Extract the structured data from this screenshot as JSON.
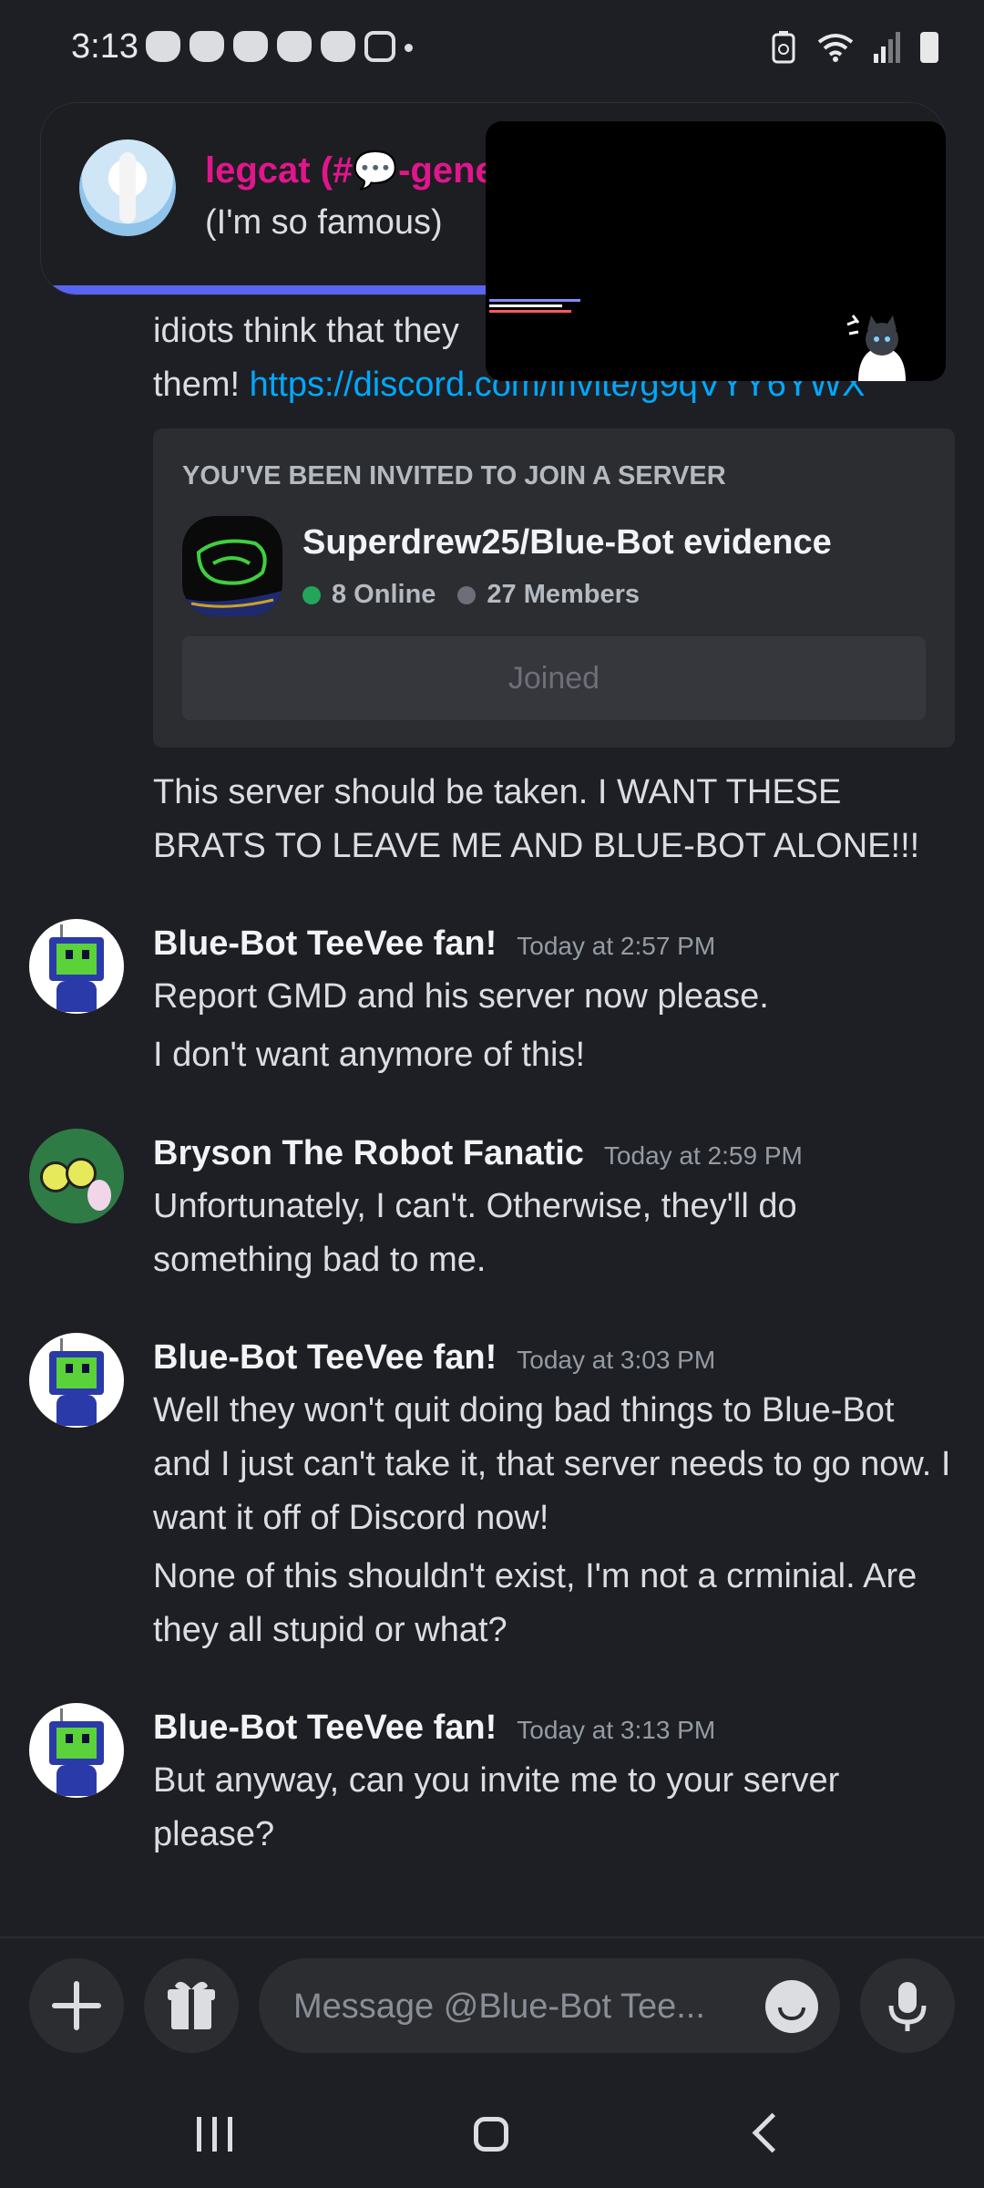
{
  "status_bar": {
    "time": "3:13",
    "notification_icons": [
      "discord-icon",
      "discord-icon",
      "discord-icon",
      "discord-icon",
      "discord-icon",
      "instagram-icon"
    ]
  },
  "notification": {
    "title": "legcat (#💬-general)",
    "text": "(I'm so famous)"
  },
  "chat": {
    "partial_message": {
      "line1": "idiots think that they",
      "line2_prefix": "them! ",
      "link": "https://discord.com/invite/g9qVYY6YWX"
    },
    "invite": {
      "header": "YOU'VE BEEN INVITED TO JOIN A SERVER",
      "server_name": "Superdrew25/Blue-Bot evidence",
      "online": "8 Online",
      "members": "27 Members",
      "button": "Joined"
    },
    "message_after_invite": "This server should be taken. I WANT THESE BRATS TO LEAVE ME AND BLUE-BOT ALONE!!!",
    "messages": [
      {
        "author": "Blue-Bot TeeVee fan!",
        "timestamp": "Today at 2:57 PM",
        "lines": [
          "Report GMD and his server now please.",
          "I don't want anymore of this!"
        ]
      },
      {
        "author": "Bryson The Robot Fanatic",
        "timestamp": "Today at 2:59 PM",
        "lines": [
          "Unfortunately, I can't. Otherwise, they'll do something bad to me."
        ]
      },
      {
        "author": "Blue-Bot TeeVee fan!",
        "timestamp": "Today at 3:03 PM",
        "lines": [
          "Well they won't quit doing bad things to Blue-Bot and I just can't take it, that server needs to go now. I want it off of Discord now!",
          "None of this shouldn't exist, I'm not a crminial. Are they all stupid or what?"
        ]
      },
      {
        "author": "Blue-Bot TeeVee fan!",
        "timestamp": "Today at 3:13 PM",
        "lines": [
          "But anyway, can you invite me to your server please?"
        ]
      }
    ]
  },
  "composer": {
    "placeholder": "Message @Blue-Bot Tee..."
  },
  "colors": {
    "background": "#1e1f24",
    "link": "#00a8fc",
    "notification_title": "#e1158c",
    "accent": "#5865f2",
    "online": "#23a55a"
  }
}
